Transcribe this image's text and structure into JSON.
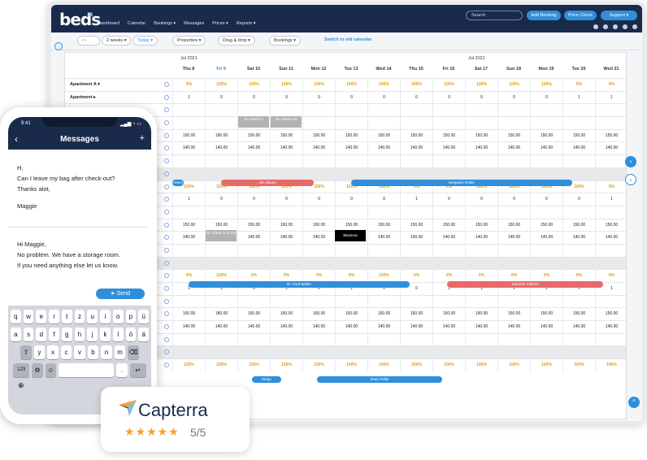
{
  "app": {
    "logo": "beds",
    "logo_sup": "24"
  },
  "nav": [
    "Dashboard",
    "Calendar",
    "Bookings ▾",
    "Messages",
    "Prices ▾",
    "Reports ▾"
  ],
  "topbar": {
    "search_placeholder": "Search",
    "add_booking": "Add Booking",
    "price_check": "Price Check",
    "support": "Support ▾"
  },
  "toolbar": {
    "weeks": "2 weeks ▾",
    "today": "Today ▾",
    "properties": "Properties ▾",
    "drag": "Drag & drop ▾",
    "bookings": "Bookings ▾",
    "old_calendar": "Switch to old calendar"
  },
  "months": {
    "m1": "Jul 2021",
    "m2": "Jul 2021"
  },
  "days": [
    "Thu 8",
    "Fri 9",
    "Sat 10",
    "Sun 11",
    "Mon 12",
    "Tue 13",
    "Wed 14",
    "Thu 15",
    "Fri 16",
    "Sat 17",
    "Sun 18",
    "Mon 19",
    "Tue 20",
    "Wed 21"
  ],
  "rows": [
    {
      "label": "Apartment A ▾",
      "cells": [
        "0%",
        "100%",
        "100%",
        "100%",
        "100%",
        "100%",
        "100%",
        "100%",
        "100%",
        "100%",
        "100%",
        "100%",
        "0%",
        "0%"
      ],
      "pct": true
    },
    {
      "label": "Apartment ▸",
      "cells": [
        "1",
        "0",
        "0",
        "0",
        "0",
        "0",
        "0",
        "0",
        "0",
        "0",
        "0",
        "0",
        "1",
        "1"
      ]
    },
    {
      "label": "",
      "cells": [
        "",
        "",
        "",
        "",
        "",
        "",
        "",
        "",
        "",
        "",
        "",
        "",
        "",
        ""
      ]
    },
    {
      "label": "",
      "cells": [
        "",
        "",
        "",
        "",
        "",
        "",
        "",
        "",
        "",
        "",
        "",
        "",
        "",
        ""
      ]
    },
    {
      "label": "",
      "cells": [
        "150.00",
        "180.00",
        "150.00",
        "150.00",
        "150.00",
        "150.00",
        "150.00",
        "150.00",
        "150.00",
        "150.00",
        "150.00",
        "150.00",
        "150.00",
        "150.00"
      ]
    },
    {
      "label": "",
      "cells": [
        "140.00",
        "140.00",
        "140.00",
        "140.00",
        "140.00",
        "140.00",
        "140.00",
        "140.00",
        "140.00",
        "140.00",
        "140.00",
        "140.00",
        "140.00",
        "140.00"
      ]
    },
    {
      "label": "",
      "cells": [
        "",
        "",
        "",
        "",
        "",
        "",
        "",
        "",
        "",
        "",
        "",
        "",
        "",
        ""
      ]
    },
    {
      "label": "",
      "cells": [
        "",
        "",
        "",
        "",
        "",
        "",
        "",
        "",
        "",
        "",
        "",
        "",
        "",
        ""
      ],
      "sep": true
    },
    {
      "label": "",
      "cells": [
        "100%",
        "100%",
        "100%",
        "100%",
        "100%",
        "100%",
        "100%",
        "0%",
        "0%",
        "100%",
        "100%",
        "100%",
        "100%",
        "0%"
      ],
      "pct": true
    },
    {
      "label": "",
      "cells": [
        "1",
        "0",
        "0",
        "0",
        "0",
        "0",
        "0",
        "1",
        "0",
        "0",
        "0",
        "0",
        "0",
        "1"
      ]
    },
    {
      "label": "",
      "cells": [
        "",
        "",
        "",
        "",
        "",
        "",
        "",
        "",
        "",
        "",
        "",
        "",
        "",
        ""
      ]
    },
    {
      "label": "",
      "cells": [
        "150.00",
        "150.00",
        "150.00",
        "150.00",
        "150.00",
        "150.00",
        "150.00",
        "150.00",
        "150.00",
        "150.00",
        "150.00",
        "150.00",
        "150.00",
        "150.00"
      ]
    },
    {
      "label": "",
      "cells": [
        "140.00",
        "140.00",
        "140.00",
        "140.00",
        "140.00",
        "140.00",
        "140.00",
        "140.00",
        "140.00",
        "140.00",
        "140.00",
        "140.00",
        "140.00",
        "140.00"
      ]
    },
    {
      "label": "",
      "cells": [
        "",
        "",
        "",
        "",
        "",
        "",
        "",
        "",
        "",
        "",
        "",
        "",
        "",
        ""
      ]
    },
    {
      "label": "",
      "cells": [
        "",
        "",
        "",
        "",
        "",
        "",
        "",
        "",
        "",
        "",
        "",
        "",
        "",
        ""
      ],
      "sep": true
    },
    {
      "label": "",
      "cells": [
        "0%",
        "100%",
        "0%",
        "0%",
        "0%",
        "0%",
        "100%",
        "0%",
        "0%",
        "0%",
        "0%",
        "0%",
        "0%",
        "0%"
      ],
      "pct": true
    },
    {
      "label": "",
      "cells": [
        "1",
        "1",
        "0",
        "1",
        "0",
        "1",
        "0",
        "0",
        "1",
        "1",
        "1",
        "1",
        "1",
        "1"
      ]
    },
    {
      "label": "",
      "cells": [
        "",
        "",
        "",
        "",
        "",
        "",
        "",
        "",
        "",
        "",
        "",
        "",
        "",
        ""
      ]
    },
    {
      "label": "",
      "cells": [
        "150.00",
        "180.00",
        "150.00",
        "150.00",
        "150.00",
        "150.00",
        "150.00",
        "150.00",
        "150.00",
        "150.00",
        "150.00",
        "150.00",
        "150.00",
        "150.00"
      ]
    },
    {
      "label": "",
      "cells": [
        "140.00",
        "140.00",
        "140.00",
        "140.00",
        "140.00",
        "140.00",
        "140.00",
        "140.00",
        "140.00",
        "140.00",
        "140.00",
        "140.00",
        "140.00",
        "140.00"
      ]
    },
    {
      "label": "",
      "cells": [
        "",
        "",
        "",
        "",
        "",
        "",
        "",
        "",
        "",
        "",
        "",
        "",
        "",
        ""
      ]
    },
    {
      "label": "",
      "cells": [
        "",
        "",
        "",
        "",
        "",
        "",
        "",
        "",
        "",
        "",
        "",
        "",
        "",
        ""
      ],
      "sep": true
    },
    {
      "label": "",
      "cells": [
        "100%",
        "100%",
        "100%",
        "100%",
        "100%",
        "100%",
        "100%",
        "100%",
        "100%",
        "100%",
        "100%",
        "100%",
        "100%",
        "100%"
      ],
      "pct": true
    }
  ],
  "bookings": {
    "b1": "Hanry",
    "b2": "Jim Shuns",
    "b3": "Benjamin Daller",
    "b4": "Dr. Paul Walter",
    "b5": "Jannette Fabrino",
    "b6": "Diego",
    "b7": "Sean Pellar"
  },
  "blocks": {
    "nci": "No check in",
    "nco": "No check out",
    "ncio": "No check in or out",
    "blackout": "Blackout"
  },
  "phone": {
    "time": "9:41",
    "status": "▂▄▆ ◔ ▭",
    "title": "Messages",
    "msg1": [
      "H,",
      "Can I leave my bag after check-out?",
      "Thanks alot,",
      "",
      "Maggie"
    ],
    "msg2": [
      "Hi Maggie,",
      "No problem. We have a storage room.",
      "If you need anything else let us know."
    ],
    "send": "Send",
    "keys1": [
      "q",
      "w",
      "e",
      "r",
      "t",
      "z",
      "u",
      "i",
      "o",
      "p",
      "ü"
    ],
    "keys2": [
      "a",
      "s",
      "d",
      "f",
      "g",
      "h",
      "j",
      "k",
      "l",
      "ö",
      "ä"
    ],
    "keys3": [
      "y",
      "x",
      "c",
      "v",
      "b",
      "n",
      "m"
    ],
    "key_123": "123"
  },
  "capterra": {
    "name": "Capterra",
    "stars": "★★★★★",
    "rating": "5/5"
  },
  "colors": {
    "navy": "#1a2a4b",
    "blue": "#2f8fdb",
    "red": "#e76a6a",
    "orange": "#e0a10a"
  }
}
